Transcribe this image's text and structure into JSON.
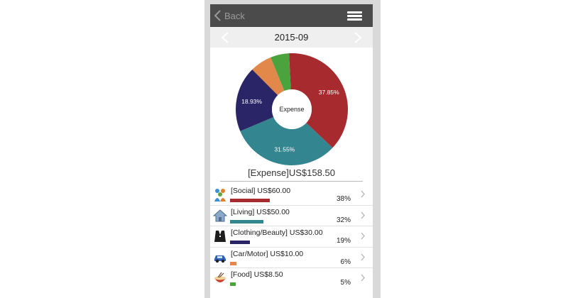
{
  "nav": {
    "back_label": "Back",
    "back_icon": "chevron-left-icon",
    "menu_icon": "hamburger-menu-icon"
  },
  "period": {
    "label": "2015-09",
    "prev_icon": "chevron-left-icon",
    "next_icon": "chevron-right-icon"
  },
  "chart_data": {
    "type": "pie",
    "center_label": "Expense",
    "categories": [
      "Social",
      "Living",
      "Clothing/Beauty",
      "Car/Motor",
      "Food"
    ],
    "values": [
      37.85,
      31.55,
      18.93,
      6.31,
      5.36
    ],
    "labels": [
      "37.85%",
      "31.55%",
      "18.93%",
      "",
      ""
    ],
    "colors": [
      "#a72a2e",
      "#33868f",
      "#2a2567",
      "#e2884a",
      "#4aa33d"
    ]
  },
  "total_label": "[Expense]US$158.50",
  "categories": [
    {
      "label": "[Social] US$60.00",
      "percent": "38%",
      "share": 0.38,
      "color": "#a72a2e",
      "icon": "people-icon"
    },
    {
      "label": "[Living] US$50.00",
      "percent": "32%",
      "share": 0.32,
      "color": "#33868f",
      "icon": "house-icon"
    },
    {
      "label": "[Clothing/Beauty] US$30.00",
      "percent": "19%",
      "share": 0.19,
      "color": "#2a2567",
      "icon": "tuxedo-icon"
    },
    {
      "label": "[Car/Motor] US$10.00",
      "percent": "6%",
      "share": 0.06,
      "color": "#e2884a",
      "icon": "car-icon"
    },
    {
      "label": "[Food] US$8.50",
      "percent": "5%",
      "share": 0.05,
      "color": "#4aa33d",
      "icon": "food-bowl-icon"
    }
  ]
}
